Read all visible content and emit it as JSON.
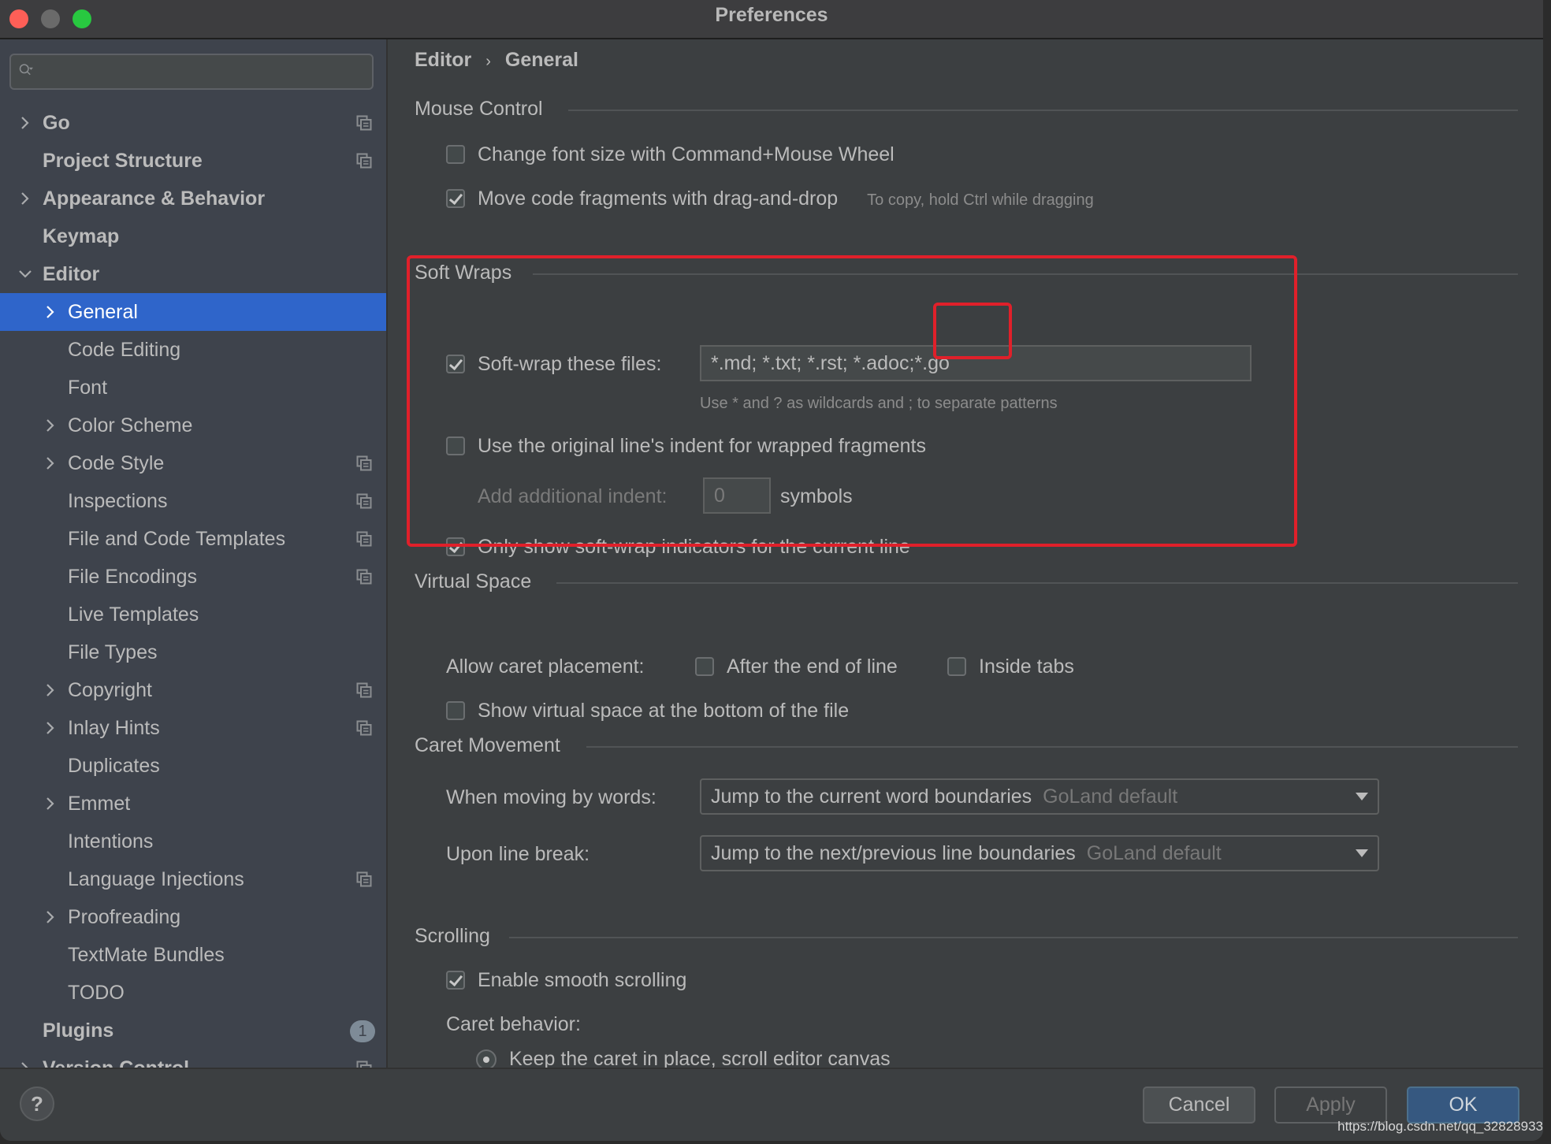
{
  "window": {
    "title": "Preferences",
    "controls": [
      "close",
      "minimize",
      "maximize"
    ]
  },
  "sidebar": {
    "search": {
      "value": "",
      "placeholder": ""
    },
    "items": [
      {
        "label": "Go",
        "level": 0,
        "expandable": true,
        "expanded": false,
        "project_icon": true
      },
      {
        "label": "Project Structure",
        "level": 0,
        "expandable": false,
        "project_icon": true
      },
      {
        "label": "Appearance & Behavior",
        "level": 0,
        "expandable": true,
        "expanded": false,
        "project_icon": false
      },
      {
        "label": "Keymap",
        "level": 0,
        "expandable": false,
        "project_icon": false
      },
      {
        "label": "Editor",
        "level": 0,
        "expandable": true,
        "expanded": true,
        "project_icon": false
      },
      {
        "label": "General",
        "level": 1,
        "expandable": true,
        "expanded": false,
        "selected": true,
        "project_icon": false
      },
      {
        "label": "Code Editing",
        "level": 1,
        "expandable": false,
        "project_icon": false
      },
      {
        "label": "Font",
        "level": 1,
        "expandable": false,
        "project_icon": false
      },
      {
        "label": "Color Scheme",
        "level": 1,
        "expandable": true,
        "expanded": false,
        "project_icon": false
      },
      {
        "label": "Code Style",
        "level": 1,
        "expandable": true,
        "expanded": false,
        "project_icon": true
      },
      {
        "label": "Inspections",
        "level": 1,
        "expandable": false,
        "project_icon": true
      },
      {
        "label": "File and Code Templates",
        "level": 1,
        "expandable": false,
        "project_icon": true
      },
      {
        "label": "File Encodings",
        "level": 1,
        "expandable": false,
        "project_icon": true
      },
      {
        "label": "Live Templates",
        "level": 1,
        "expandable": false,
        "project_icon": false
      },
      {
        "label": "File Types",
        "level": 1,
        "expandable": false,
        "project_icon": false
      },
      {
        "label": "Copyright",
        "level": 1,
        "expandable": true,
        "expanded": false,
        "project_icon": true
      },
      {
        "label": "Inlay Hints",
        "level": 1,
        "expandable": true,
        "expanded": false,
        "project_icon": true
      },
      {
        "label": "Duplicates",
        "level": 1,
        "expandable": false,
        "project_icon": false
      },
      {
        "label": "Emmet",
        "level": 1,
        "expandable": true,
        "expanded": false,
        "project_icon": false
      },
      {
        "label": "Intentions",
        "level": 1,
        "expandable": false,
        "project_icon": false
      },
      {
        "label": "Language Injections",
        "level": 1,
        "expandable": false,
        "project_icon": true
      },
      {
        "label": "Proofreading",
        "level": 1,
        "expandable": true,
        "expanded": false,
        "project_icon": false
      },
      {
        "label": "TextMate Bundles",
        "level": 1,
        "expandable": false,
        "project_icon": false
      },
      {
        "label": "TODO",
        "level": 1,
        "expandable": false,
        "project_icon": false
      },
      {
        "label": "Plugins",
        "level": 0,
        "expandable": false,
        "badge": "1",
        "project_icon": false
      },
      {
        "label": "Version Control",
        "level": 0,
        "expandable": true,
        "expanded": false,
        "project_icon": true
      }
    ]
  },
  "breadcrumb": {
    "parent": "Editor",
    "separator": "›",
    "current": "General"
  },
  "mouse_control": {
    "title": "Mouse Control",
    "change_font_size": {
      "label": "Change font size with Command+Mouse Wheel",
      "checked": false
    },
    "move_code_fragments": {
      "label": "Move code fragments with drag-and-drop",
      "checked": true,
      "hint": "To copy, hold Ctrl while dragging"
    }
  },
  "soft_wraps": {
    "title": "Soft Wraps",
    "soft_wrap_files": {
      "label": "Soft-wrap these files:",
      "checked": true,
      "value": "*.md; *.txt; *.rst; *.adoc;*.go",
      "hint": "Use * and ? as wildcards and ; to separate patterns"
    },
    "original_indent": {
      "label": "Use the original line's indent for wrapped fragments",
      "checked": false
    },
    "additional_indent": {
      "label": "Add additional indent:",
      "value": "0",
      "suffix": "symbols"
    },
    "only_current_line": {
      "label": "Only show soft-wrap indicators for the current line",
      "checked": true
    }
  },
  "virtual_space": {
    "title": "Virtual Space",
    "allow_caret_label": "Allow caret placement:",
    "after_end_of_line": {
      "label": "After the end of line",
      "checked": false
    },
    "inside_tabs": {
      "label": "Inside tabs",
      "checked": false
    },
    "show_virtual_space": {
      "label": "Show virtual space at the bottom of the file",
      "checked": false
    }
  },
  "caret_movement": {
    "title": "Caret Movement",
    "moving_by_words": {
      "label": "When moving by words:",
      "value": "Jump to the current word boundaries",
      "default_tag": "GoLand default"
    },
    "line_break": {
      "label": "Upon line break:",
      "value": "Jump to the next/previous line boundaries",
      "default_tag": "GoLand default"
    }
  },
  "scrolling": {
    "title": "Scrolling",
    "smooth_scrolling": {
      "label": "Enable smooth scrolling",
      "checked": true
    },
    "caret_behavior_label": "Caret behavior:",
    "keep_caret": {
      "label": "Keep the caret in place, scroll editor canvas",
      "selected": true
    }
  },
  "footer": {
    "help_label": "?",
    "cancel_label": "Cancel",
    "apply_label": "Apply",
    "ok_label": "OK",
    "apply_enabled": false
  },
  "watermark": "https://blog.csdn.net/qq_32828933",
  "colors": {
    "selection": "#2f65ca",
    "highlight_annotation": "#e0202a",
    "ok_button": "#365880"
  }
}
